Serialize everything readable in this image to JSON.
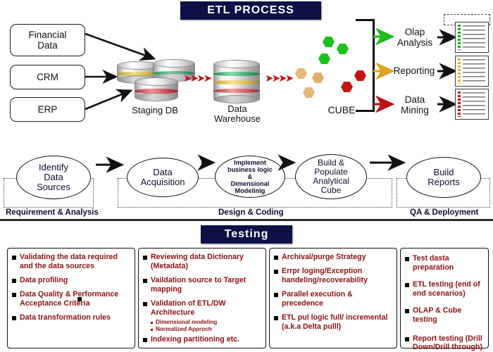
{
  "banners": {
    "etl": "ETL PROCESS",
    "testing": "Testing"
  },
  "sources": [
    {
      "label": "Financial Data",
      "name": "source-financial-data"
    },
    {
      "label": "CRM",
      "name": "source-crm"
    },
    {
      "label": "ERP",
      "name": "source-erp"
    }
  ],
  "databases": {
    "staging": "Staging DB",
    "warehouse_line1": "Data",
    "warehouse_line2": "Warehouse",
    "cube": "CUBE"
  },
  "outputs": [
    {
      "line1": "Olap",
      "line2": "Analysis",
      "color": "#1fb81f"
    },
    {
      "line1": "Reporting",
      "line2": "",
      "color": "#e0a51c"
    },
    {
      "line1": "Data",
      "line2": "Mining",
      "color": "#b91414"
    }
  ],
  "process": {
    "steps": [
      {
        "text": "Identify\nData\nSources",
        "size": "big"
      },
      {
        "text": "Data\nAcquisition",
        "size": "big"
      },
      {
        "text": "Implement\nbusiness logic\n&\nDimensional\nModelinig",
        "size": "small"
      },
      {
        "text": "Build &\nPopulate\nAnalytical\nCube",
        "size": "big"
      },
      {
        "text": "Build\nReports",
        "size": "big"
      }
    ],
    "phases": [
      {
        "label": "Requirement & Analysis"
      },
      {
        "label": "Design & Coding"
      },
      {
        "label": "QA & Deployment"
      }
    ]
  },
  "testing_columns": [
    {
      "name": "testing-column-1",
      "items": [
        {
          "text": "Validating the data  required and the data sources",
          "subs": []
        },
        {
          "text": "Data profiling",
          "subs": []
        },
        {
          "text": "Data Quality & Performance Acceptance Criteria",
          "subs": []
        },
        {
          "text": "Data transformation rules",
          "subs": []
        }
      ]
    },
    {
      "name": "testing-column-2",
      "items": [
        {
          "text": "Reviewing data Dictionary (Metadata)",
          "subs": []
        },
        {
          "text": "Vaildation source to Target mapping",
          "subs": []
        },
        {
          "text": "Validation of ETL/DW Architecture",
          "subs": [
            "Dimensional modeling",
            "Normalized Approch"
          ]
        },
        {
          "text": "Indexing partitioning etc.",
          "subs": []
        }
      ]
    },
    {
      "name": "testing-column-3",
      "items": [
        {
          "text": "Archival/purge Strategy",
          "subs": []
        },
        {
          "text": "Errpr loging/Exception  handeling/recoverability",
          "subs": []
        },
        {
          "text": "Parallel execution & precedence",
          "subs": []
        },
        {
          "text": "ETL pul logic full/ incremental (a.k.a Delta pulll)",
          "subs": []
        }
      ]
    },
    {
      "name": "testing-column-4",
      "items": [
        {
          "text": "Test dasta preparation",
          "subs": []
        },
        {
          "text": "ETL testing (end of        end scenarios)",
          "subs": []
        },
        {
          "text": "OLAP & Cube testing",
          "subs": []
        },
        {
          "text": "Report testing (Drill Down/Drill through)",
          "subs": []
        }
      ]
    }
  ],
  "colors": {
    "banner_bg": "#0e1146",
    "testing_text": "#8c1111",
    "green": "#1fb81f",
    "amber": "#e0a51c",
    "red": "#b91414",
    "tan": "#e3b878"
  }
}
